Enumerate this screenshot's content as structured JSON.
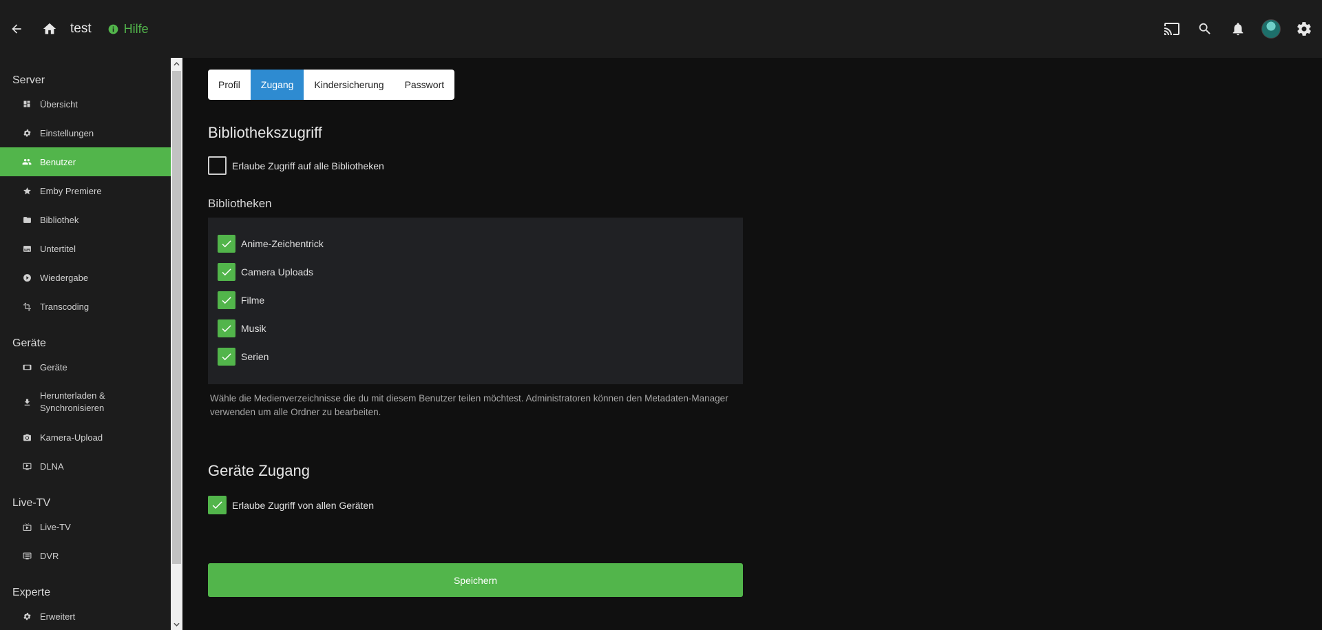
{
  "header": {
    "title": "test",
    "help_label": "Hilfe"
  },
  "sidebar": {
    "sections": [
      {
        "title": "Server",
        "items": [
          {
            "label": "Übersicht",
            "icon": "dashboard-icon"
          },
          {
            "label": "Einstellungen",
            "icon": "gear-icon"
          },
          {
            "label": "Benutzer",
            "icon": "people-icon",
            "active": true
          },
          {
            "label": "Emby Premiere",
            "icon": "star-icon"
          },
          {
            "label": "Bibliothek",
            "icon": "folder-icon"
          },
          {
            "label": "Untertitel",
            "icon": "subtitles-icon"
          },
          {
            "label": "Wiedergabe",
            "icon": "play-circle-icon"
          },
          {
            "label": "Transcoding",
            "icon": "transform-icon"
          }
        ]
      },
      {
        "title": "Geräte",
        "items": [
          {
            "label": "Geräte",
            "icon": "devices-icon"
          },
          {
            "label": "Herunterladen &\nSynchronisieren",
            "icon": "download-icon"
          },
          {
            "label": "Kamera-Upload",
            "icon": "camera-icon"
          },
          {
            "label": "DLNA",
            "icon": "dlna-icon"
          }
        ]
      },
      {
        "title": "Live-TV",
        "items": [
          {
            "label": "Live-TV",
            "icon": "tv-icon"
          },
          {
            "label": "DVR",
            "icon": "dvr-icon"
          }
        ]
      },
      {
        "title": "Experte",
        "items": [
          {
            "label": "Erweitert",
            "icon": "gear-icon"
          }
        ]
      }
    ]
  },
  "tabs": [
    {
      "label": "Profil",
      "active": false
    },
    {
      "label": "Zugang",
      "active": true
    },
    {
      "label": "Kindersicherung",
      "active": false
    },
    {
      "label": "Passwort",
      "active": false
    }
  ],
  "library_access": {
    "heading": "Bibliothekszugriff",
    "all_libraries_label": "Erlaube Zugriff auf alle Bibliotheken",
    "all_libraries_checked": false,
    "libraries_heading": "Bibliotheken",
    "libraries": [
      {
        "label": "Anime-Zeichentrick",
        "checked": true
      },
      {
        "label": "Camera Uploads",
        "checked": true
      },
      {
        "label": "Filme",
        "checked": true
      },
      {
        "label": "Musik",
        "checked": true
      },
      {
        "label": "Serien",
        "checked": true
      }
    ],
    "help_text": "Wähle die Medienverzeichnisse die du mit diesem Benutzer teilen möchtest. Administratoren können den Metadaten-Manager verwenden um alle Ordner zu bearbeiten."
  },
  "device_access": {
    "heading": "Geräte Zugang",
    "all_devices_label": "Erlaube Zugriff von allen Geräten",
    "all_devices_checked": true
  },
  "save_label": "Speichern",
  "colors": {
    "accent_green": "#52b54b",
    "tab_active_blue": "#2e8bd1"
  }
}
